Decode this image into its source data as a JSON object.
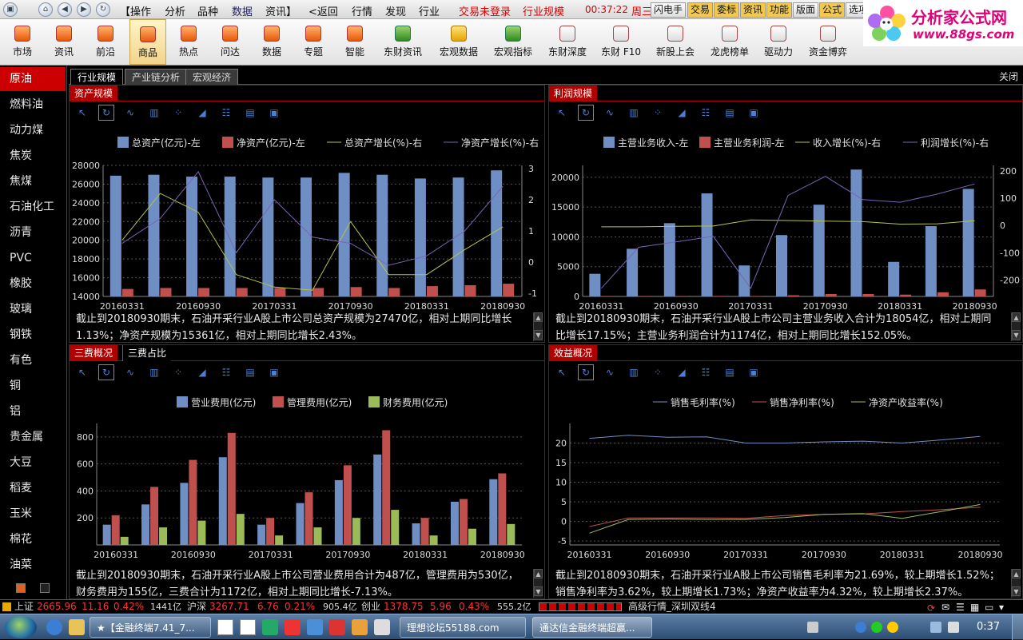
{
  "menubar": {
    "items": [
      "【操作",
      "分析",
      "品种",
      "数据",
      "资讯】",
      "<返回",
      "行情",
      "发现",
      "行业"
    ],
    "login_status": "交易未登录",
    "market_label": "行业规模",
    "clock": "00:37:22",
    "weekday": "周三",
    "right_buttons": [
      "闪电手",
      "交易",
      "委标",
      "资讯",
      "功能",
      "版面",
      "公式",
      "选项"
    ]
  },
  "logo": {
    "title": "分析家公式网",
    "url": "www.88gs.com"
  },
  "toolbar": {
    "items": [
      "市场",
      "资讯",
      "前沿",
      "商品",
      "热点",
      "问达",
      "数据",
      "专题",
      "智能",
      "东财资讯",
      "宏观数据",
      "宏观指标",
      "东财深度",
      "东财 F10",
      "新股上会",
      "龙虎榜单",
      "驱动力",
      "资金博弈"
    ],
    "selected": "商品"
  },
  "sidebar": {
    "items": [
      "原油",
      "燃料油",
      "动力煤",
      "焦炭",
      "焦煤",
      "石油化工",
      "沥青",
      "PVC",
      "橡胶",
      "玻璃",
      "钢铁",
      "有色",
      "铜",
      "铝",
      "贵金属",
      "大豆",
      "稻麦",
      "玉米",
      "棉花",
      "油菜"
    ],
    "selected": "原油"
  },
  "tabs": {
    "items": [
      "行业规模",
      "产业链分析",
      "宏观经济"
    ],
    "close_label": "关闭"
  },
  "panels": {
    "assets": {
      "title": "资产规模",
      "desc_line1": "截止到20180930期末，石油开采行业A股上市公司总资产规模为27470亿，相对上期同比增长",
      "desc_line2": "1.13%；净资产规模为15361亿，相对上期同比增长2.43%。"
    },
    "profit": {
      "title": "利润规模",
      "desc_line1": "截止到20180930期末，石油开采行业A股上市公司主营业务收入合计为18054亿，相对上期同",
      "desc_line2": "比增长17.15%；主营业务利润合计为1174亿，相对上期同比增长152.05%。"
    },
    "fees": {
      "title": "三费概况",
      "title2": "三费占比",
      "desc_line1": "截止到20180930期末，石油开采行业A股上市公司营业费用合计为487亿，管理费用为530亿，",
      "desc_line2": "财务费用为155亿，三费合计为1172亿，相对上期同比增长-7.13%。"
    },
    "efficiency": {
      "title": "效益概况",
      "desc_line1": "截止到20180930期末，石油开采行业A股上市公司销售毛利率为21.69%，较上期增长1.52%；",
      "desc_line2": "销售净利率为3.62%，较上期增长1.73%；净资产收益率为4.32%，较上期增长2.37%。"
    }
  },
  "chart_data": [
    {
      "type": "bar",
      "categories": [
        "20160331",
        "20160630",
        "20160930",
        "20161231",
        "20170331",
        "20170630",
        "20170930",
        "20171231",
        "20180331",
        "20180630",
        "20180930"
      ],
      "x_tick_labels": [
        "20160331",
        "20160930",
        "20170331",
        "20170930",
        "20180331",
        "20180930"
      ],
      "series": [
        {
          "name": "总资产(亿元)-左",
          "kind": "bar",
          "axis": "left",
          "color": "#6f8fc4",
          "values": [
            26900,
            27000,
            26800,
            26800,
            26700,
            26700,
            27200,
            27000,
            26600,
            26700,
            27470
          ]
        },
        {
          "name": "净资产(亿元)-左",
          "kind": "bar",
          "axis": "left",
          "color": "#c0504d",
          "values": [
            14800,
            14900,
            14900,
            14900,
            14900,
            14900,
            15000,
            14900,
            15100,
            15200,
            15361
          ]
        },
        {
          "name": "总资产增长(%)-右",
          "kind": "line",
          "axis": "right",
          "color": "#b5c44a",
          "values": [
            0.7,
            2.2,
            1.6,
            -0.4,
            -0.8,
            -0.9,
            1.3,
            -0.4,
            -0.4,
            0.4,
            1.13
          ]
        },
        {
          "name": "净资产增长(%)-右",
          "kind": "line",
          "axis": "right",
          "color": "#7b63b5",
          "values": [
            0.6,
            1.4,
            2.9,
            0.3,
            2.0,
            0.8,
            0.6,
            -0.1,
            0.2,
            1.0,
            2.43
          ]
        }
      ],
      "ylim_left": [
        14000,
        28000
      ],
      "yticks_left": [
        14000,
        16000,
        18000,
        20000,
        22000,
        24000,
        26000,
        28000
      ],
      "ylim_right": [
        -1.1,
        3.1
      ],
      "yticks_right": [
        -1,
        0,
        1,
        2,
        3
      ],
      "grid": true,
      "legend": "top"
    },
    {
      "type": "bar",
      "categories": [
        "20160331",
        "20160630",
        "20160930",
        "20161231",
        "20170331",
        "20170630",
        "20170930",
        "20171231",
        "20180331",
        "20180630",
        "20180930"
      ],
      "x_tick_labels": [
        "20160331",
        "20160930",
        "20170331",
        "20170930",
        "20180331",
        "20180930"
      ],
      "series": [
        {
          "name": "主营业务收入-左",
          "kind": "bar",
          "axis": "left",
          "color": "#6f8fc4",
          "values": [
            3800,
            8000,
            12300,
            17300,
            5200,
            10300,
            15400,
            21300,
            5800,
            11800,
            18054
          ]
        },
        {
          "name": "主营业务利润-左",
          "kind": "bar",
          "axis": "left",
          "color": "#c0504d",
          "values": [
            50,
            50,
            50,
            80,
            60,
            200,
            400,
            400,
            300,
            700,
            1174
          ]
        },
        {
          "name": "收入增长(%)-右",
          "kind": "line",
          "axis": "right",
          "color": "#b5c44a",
          "values": [
            -5,
            -5,
            -3,
            -2,
            20,
            18,
            16,
            14,
            5,
            6,
            17.15
          ]
        },
        {
          "name": "利润增长(%)-右",
          "kind": "line",
          "axis": "right",
          "color": "#7b63b5",
          "values": [
            -230,
            -80,
            -60,
            -40,
            -230,
            110,
            180,
            95,
            85,
            115,
            152.05
          ]
        }
      ],
      "ylim_left": [
        0,
        22000
      ],
      "yticks_left": [
        0,
        5000,
        10000,
        15000,
        20000
      ],
      "ylim_right": [
        -260,
        220
      ],
      "yticks_right": [
        -200,
        -100,
        0,
        100,
        200
      ],
      "grid": true,
      "legend": "top"
    },
    {
      "type": "bar",
      "categories": [
        "20160331",
        "20160630",
        "20160930",
        "20161231",
        "20170331",
        "20170630",
        "20170930",
        "20171231",
        "20180331",
        "20180630",
        "20180930"
      ],
      "x_tick_labels": [
        "20160331",
        "20160930",
        "20170331",
        "20170930",
        "20180331",
        "20180930"
      ],
      "series": [
        {
          "name": "营业费用(亿元)",
          "kind": "bar",
          "axis": "left",
          "color": "#6f8fc4",
          "values": [
            150,
            300,
            460,
            650,
            150,
            310,
            480,
            670,
            160,
            320,
            487
          ]
        },
        {
          "name": "管理费用(亿元)",
          "kind": "bar",
          "axis": "left",
          "color": "#c0504d",
          "values": [
            220,
            430,
            630,
            830,
            200,
            390,
            590,
            850,
            200,
            340,
            530
          ]
        },
        {
          "name": "财务费用(亿元)",
          "kind": "bar",
          "axis": "left",
          "color": "#9bbb59",
          "values": [
            60,
            130,
            180,
            230,
            70,
            130,
            200,
            260,
            70,
            120,
            155
          ]
        }
      ],
      "ylim_left": [
        0,
        900
      ],
      "yticks_left": [
        200,
        400,
        600,
        800
      ],
      "grid": true,
      "legend": "top"
    },
    {
      "type": "line",
      "categories": [
        "20160331",
        "20160630",
        "20160930",
        "20161231",
        "20170331",
        "20170630",
        "20170930",
        "20171231",
        "20180331",
        "20180630",
        "20180930"
      ],
      "x_tick_labels": [
        "20160331",
        "20160930",
        "20170331",
        "20170930",
        "20180331",
        "20180930"
      ],
      "series": [
        {
          "name": "销售毛利率(%)",
          "kind": "line",
          "axis": "left",
          "color": "#6f8fc4",
          "values": [
            21.2,
            22.0,
            21.5,
            21.6,
            20.0,
            20.0,
            20.3,
            20.5,
            20.0,
            20.8,
            21.69
          ]
        },
        {
          "name": "销售净利率(%)",
          "kind": "line",
          "axis": "left",
          "color": "#c0504d",
          "values": [
            -1.3,
            0.9,
            0.9,
            0.9,
            0.8,
            1.5,
            1.8,
            1.9,
            2.5,
            3.0,
            3.62
          ]
        },
        {
          "name": "净资产收益率(%)",
          "kind": "line",
          "axis": "left",
          "color": "#9bbb59",
          "values": [
            -3.0,
            0.5,
            0.6,
            0.5,
            0.5,
            1.0,
            1.8,
            2.0,
            0.8,
            2.5,
            4.32
          ]
        }
      ],
      "ylim_left": [
        -6,
        25
      ],
      "yticks_left": [
        -5,
        0,
        5,
        10,
        15,
        20
      ],
      "grid": true,
      "legend": "top"
    }
  ],
  "status_bar": {
    "sh_label": "上证",
    "sh_value": "2665.96",
    "sh_change": "11.16",
    "sh_pct": "0.42%",
    "sh_vol": "1441亿",
    "sz_label": "沪深",
    "sz_value": "3267.71",
    "sz_change": "6.76",
    "sz_pct": "0.21%",
    "sz_vol": "905.4亿",
    "cy_label": "创业",
    "cy_value": "1378.75",
    "cy_change": "5.96",
    "cy_pct": "0.43%",
    "cy_vol": "555.2亿",
    "server": "高级行情_深圳双线4"
  },
  "taskbar": {
    "apps": [
      "★【金融终端7.41_7...",
      "理想论坛55188.com",
      "通达信金融终端超赢..."
    ],
    "time": "0:37"
  }
}
